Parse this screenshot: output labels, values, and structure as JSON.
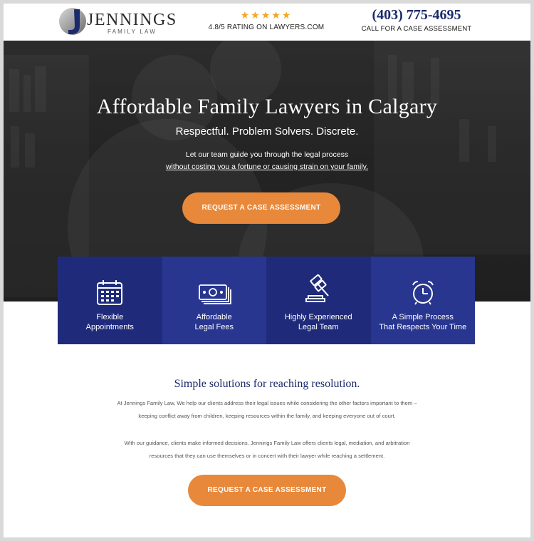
{
  "header": {
    "logo_name": "JENNINGS",
    "logo_sub": "FAMILY LAW",
    "stars": "★★★★★",
    "rating_text": "4.8/5 RATING ON LAWYERS.COM",
    "phone": "(403) 775-4695",
    "phone_sub": "CALL FOR A CASE ASSESSMENT"
  },
  "hero": {
    "title": "Affordable Family Lawyers in Calgary",
    "subtitle": "Respectful. Problem Solvers. Discrete.",
    "line1": "Let our team guide you through the legal process",
    "line2": "without costing you a fortune or causing strain on your family.",
    "cta": "REQUEST A CASE ASSESSMENT"
  },
  "features": [
    {
      "line1": "Flexible",
      "line2": "Appointments",
      "icon": "calendar-icon"
    },
    {
      "line1": "Affordable",
      "line2": "Legal Fees",
      "icon": "money-icon"
    },
    {
      "line1": "Highly Experienced",
      "line2": "Legal Team",
      "icon": "gavel-icon"
    },
    {
      "line1": "A Simple Process",
      "line2": "That Respects Your Time",
      "icon": "alarm-clock-icon"
    }
  ],
  "content": {
    "title": "Simple solutions for reaching resolution.",
    "p1": "At Jennings Family Law, We help our clients address their legal issues while considering the other factors important to them – keeping conflict away from children, keeping resources within the family, and keeping everyone out of court.",
    "p2": "With our guidance, clients make informed decisions. Jennings Family Law offers clients legal, mediation, and arbitration resources that they can use themselves or in concert with their lawyer while reaching a settlement.",
    "cta": "REQUEST A CASE ASSESSMENT"
  },
  "colors": {
    "navy": "#1b2a6b",
    "feature_dark": "#1f2b7a",
    "feature_light": "#283690",
    "orange": "#e8883a",
    "star": "#f5a623"
  }
}
